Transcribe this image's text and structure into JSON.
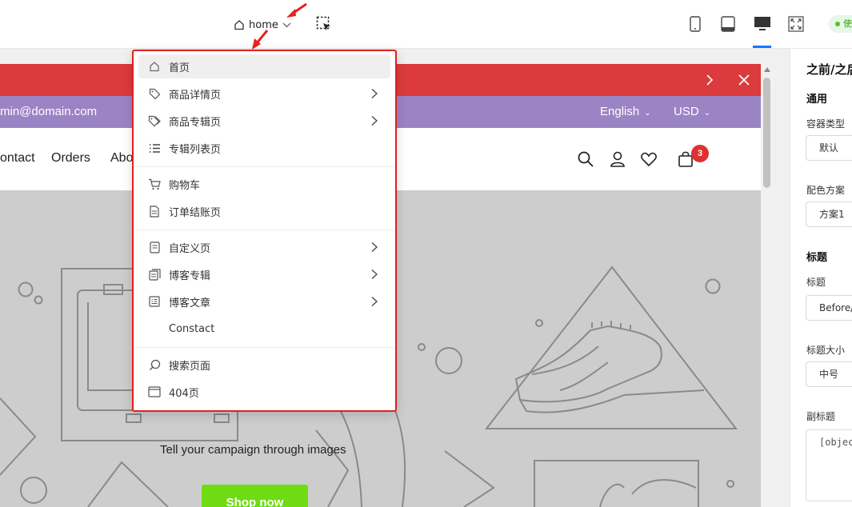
{
  "topbar": {
    "page_select_label": "home",
    "status_label": "使",
    "devices": [
      "mobile-icon",
      "tablet-icon",
      "desktop-icon",
      "fullscreen-icon"
    ],
    "active_device": "desktop-icon"
  },
  "store": {
    "email": "min@domain.com",
    "language": "English",
    "currency": "USD",
    "nav_links": [
      "ontact",
      "Orders",
      "Abo"
    ],
    "cart_count": "3",
    "hero_text": "Tell your campaign through images",
    "hero_button": "Shop now",
    "colors": {
      "announcement": "#db3b3d",
      "subbar": "#9b84c4",
      "hero_bg": "#cdcdcd",
      "button": "#6fdc13"
    }
  },
  "dropdown": {
    "items": [
      {
        "label": "首页",
        "icon": "home-icon",
        "submenu": false
      },
      {
        "label": "商品详情页",
        "icon": "tag-icon",
        "submenu": true
      },
      {
        "label": "商品专辑页",
        "icon": "tags-icon",
        "submenu": true
      },
      {
        "label": "专辑列表页",
        "icon": "list-icon",
        "submenu": false
      },
      {
        "label": "购物车",
        "icon": "cart-icon",
        "submenu": false
      },
      {
        "label": "订单结账页",
        "icon": "document-icon",
        "submenu": false
      },
      {
        "label": "自定义页",
        "icon": "page-icon",
        "submenu": true
      },
      {
        "label": "博客专辑",
        "icon": "copy-icon",
        "submenu": true
      },
      {
        "label": "博客文章",
        "icon": "article-icon",
        "submenu": true
      },
      {
        "label": "Constact",
        "icon": "",
        "submenu": false
      },
      {
        "label": "搜索页面",
        "icon": "search-icon",
        "submenu": false
      },
      {
        "label": "404页",
        "icon": "window-icon",
        "submenu": false
      }
    ],
    "active_item": "首页"
  },
  "panel": {
    "title": "之前/之后",
    "section_general": "通用",
    "container_type_label": "容器类型",
    "container_type_value": "默认",
    "color_scheme_label": "配色方案",
    "color_scheme_value": "方案1",
    "section_heading": "标题",
    "heading_label": "标题",
    "heading_value": "Before/After",
    "heading_size_label": "标题大小",
    "heading_size_value": "中号",
    "subheading_label": "副标题",
    "subheading_value": "[object Object]"
  }
}
